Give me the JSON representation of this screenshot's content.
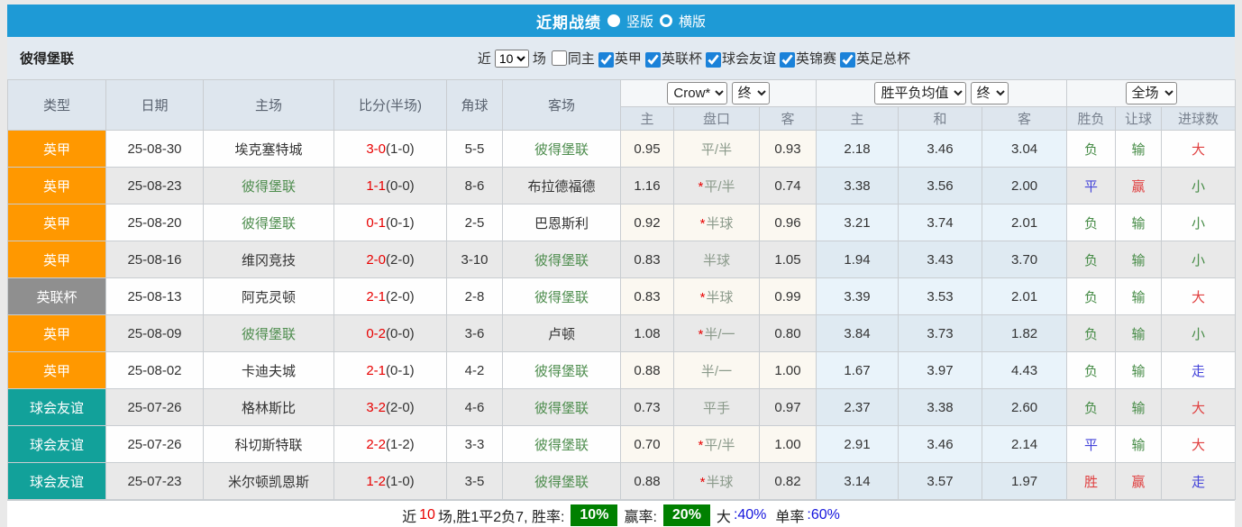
{
  "title_bar": {
    "title": "近期战绩",
    "vertical_label": "竖版",
    "horizontal_label": "横版",
    "bar_color": "#1e9ad6",
    "vertical_selected": true
  },
  "filter_bar": {
    "team": "彼得堡联",
    "recent_label": "近",
    "recent_value": "10",
    "games_label": "场",
    "same_home_label": "同主",
    "same_home_checked": false,
    "leagues": [
      {
        "label": "英甲",
        "checked": true
      },
      {
        "label": "英联杯",
        "checked": true
      },
      {
        "label": "球会友谊",
        "checked": true
      },
      {
        "label": "英锦赛",
        "checked": true
      },
      {
        "label": "英足总杯",
        "checked": true
      }
    ]
  },
  "league_colors": {
    "英甲": "#ff9800",
    "英联杯": "#8f8f8f",
    "球会友谊": "#12a19a"
  },
  "colors": {
    "green": "#478c47",
    "red": "#e04040",
    "blue": "#4343d9",
    "team_green": "#4e8d4e",
    "score_red": "#e80000",
    "footer_green_bg": "#008000"
  },
  "table": {
    "headers_left": [
      "类型",
      "日期",
      "主场",
      "比分(半场)",
      "角球",
      "客场"
    ],
    "selects": {
      "company": "Crow*",
      "time1": "终",
      "avg": "胜平负均值",
      "time2": "终",
      "scope": "全场"
    },
    "subheaders": [
      "主",
      "盘口",
      "客",
      "主",
      "和",
      "客",
      "胜负",
      "让球",
      "进球数"
    ],
    "rows": [
      {
        "type": "英甲",
        "date": "25-08-30",
        "home": "埃克塞特城",
        "home_focus": false,
        "score": "3-0",
        "half": "(1-0)",
        "corner": "5-5",
        "away": "彼得堡联",
        "away_focus": true,
        "crow_home": "0.95",
        "star": false,
        "handicap": "平/半",
        "crow_away": "0.93",
        "avg_home": "2.18",
        "avg_draw": "3.46",
        "avg_away": "3.04",
        "wdl": "负",
        "wdl_color": "green",
        "let": "输",
        "let_color": "green",
        "goal": "大",
        "goal_color": "red"
      },
      {
        "type": "英甲",
        "date": "25-08-23",
        "home": "彼得堡联",
        "home_focus": true,
        "score": "1-1",
        "half": "(0-0)",
        "corner": "8-6",
        "away": "布拉德福德",
        "away_focus": false,
        "crow_home": "1.16",
        "star": true,
        "handicap": "平/半",
        "crow_away": "0.74",
        "avg_home": "3.38",
        "avg_draw": "3.56",
        "avg_away": "2.00",
        "wdl": "平",
        "wdl_color": "blue",
        "let": "赢",
        "let_color": "red",
        "goal": "小",
        "goal_color": "green"
      },
      {
        "type": "英甲",
        "date": "25-08-20",
        "home": "彼得堡联",
        "home_focus": true,
        "score": "0-1",
        "half": "(0-1)",
        "corner": "2-5",
        "away": "巴恩斯利",
        "away_focus": false,
        "crow_home": "0.92",
        "star": true,
        "handicap": "半球",
        "crow_away": "0.96",
        "avg_home": "3.21",
        "avg_draw": "3.74",
        "avg_away": "2.01",
        "wdl": "负",
        "wdl_color": "green",
        "let": "输",
        "let_color": "green",
        "goal": "小",
        "goal_color": "green"
      },
      {
        "type": "英甲",
        "date": "25-08-16",
        "home": "维冈竞技",
        "home_focus": false,
        "score": "2-0",
        "half": "(2-0)",
        "corner": "3-10",
        "away": "彼得堡联",
        "away_focus": true,
        "crow_home": "0.83",
        "star": false,
        "handicap": "半球",
        "crow_away": "1.05",
        "avg_home": "1.94",
        "avg_draw": "3.43",
        "avg_away": "3.70",
        "wdl": "负",
        "wdl_color": "green",
        "let": "输",
        "let_color": "green",
        "goal": "小",
        "goal_color": "green"
      },
      {
        "type": "英联杯",
        "date": "25-08-13",
        "home": "阿克灵顿",
        "home_focus": false,
        "score": "2-1",
        "half": "(2-0)",
        "corner": "2-8",
        "away": "彼得堡联",
        "away_focus": true,
        "crow_home": "0.83",
        "star": true,
        "handicap": "半球",
        "crow_away": "0.99",
        "avg_home": "3.39",
        "avg_draw": "3.53",
        "avg_away": "2.01",
        "wdl": "负",
        "wdl_color": "green",
        "let": "输",
        "let_color": "green",
        "goal": "大",
        "goal_color": "red"
      },
      {
        "type": "英甲",
        "date": "25-08-09",
        "home": "彼得堡联",
        "home_focus": true,
        "score": "0-2",
        "half": "(0-0)",
        "corner": "3-6",
        "away": "卢顿",
        "away_focus": false,
        "crow_home": "1.08",
        "star": true,
        "handicap": "半/一",
        "crow_away": "0.80",
        "avg_home": "3.84",
        "avg_draw": "3.73",
        "avg_away": "1.82",
        "wdl": "负",
        "wdl_color": "green",
        "let": "输",
        "let_color": "green",
        "goal": "小",
        "goal_color": "green"
      },
      {
        "type": "英甲",
        "date": "25-08-02",
        "home": "卡迪夫城",
        "home_focus": false,
        "score": "2-1",
        "half": "(0-1)",
        "corner": "4-2",
        "away": "彼得堡联",
        "away_focus": true,
        "crow_home": "0.88",
        "star": false,
        "handicap": "半/一",
        "crow_away": "1.00",
        "avg_home": "1.67",
        "avg_draw": "3.97",
        "avg_away": "4.43",
        "wdl": "负",
        "wdl_color": "green",
        "let": "输",
        "let_color": "green",
        "goal": "走",
        "goal_color": "blue"
      },
      {
        "type": "球会友谊",
        "date": "25-07-26",
        "home": "格林斯比",
        "home_focus": false,
        "score": "3-2",
        "half": "(2-0)",
        "corner": "4-6",
        "away": "彼得堡联",
        "away_focus": true,
        "crow_home": "0.73",
        "star": false,
        "handicap": "平手",
        "crow_away": "0.97",
        "avg_home": "2.37",
        "avg_draw": "3.38",
        "avg_away": "2.60",
        "wdl": "负",
        "wdl_color": "green",
        "let": "输",
        "let_color": "green",
        "goal": "大",
        "goal_color": "red"
      },
      {
        "type": "球会友谊",
        "date": "25-07-26",
        "home": "科切斯特联",
        "home_focus": false,
        "score": "2-2",
        "half": "(1-2)",
        "corner": "3-3",
        "away": "彼得堡联",
        "away_focus": true,
        "crow_home": "0.70",
        "star": true,
        "handicap": "平/半",
        "crow_away": "1.00",
        "avg_home": "2.91",
        "avg_draw": "3.46",
        "avg_away": "2.14",
        "wdl": "平",
        "wdl_color": "blue",
        "let": "输",
        "let_color": "green",
        "goal": "大",
        "goal_color": "red"
      },
      {
        "type": "球会友谊",
        "date": "25-07-23",
        "home": "米尔顿凯恩斯",
        "home_focus": false,
        "score": "1-2",
        "half": "(1-0)",
        "corner": "3-5",
        "away": "彼得堡联",
        "away_focus": true,
        "crow_home": "0.88",
        "star": true,
        "handicap": "半球",
        "crow_away": "0.82",
        "avg_home": "3.14",
        "avg_draw": "3.57",
        "avg_away": "1.97",
        "wdl": "胜",
        "wdl_color": "red",
        "let": "赢",
        "let_color": "red",
        "goal": "走",
        "goal_color": "blue"
      }
    ]
  },
  "footer": {
    "prefix": "近",
    "count": "10",
    "summary": "场,胜1平2负7, 胜率:",
    "win_rate": "10%",
    "win_label": "赢率:",
    "win_value": "20%",
    "big_label": "大",
    "big_value": ":40%",
    "single_label": "单率",
    "single_value": ":60%"
  }
}
